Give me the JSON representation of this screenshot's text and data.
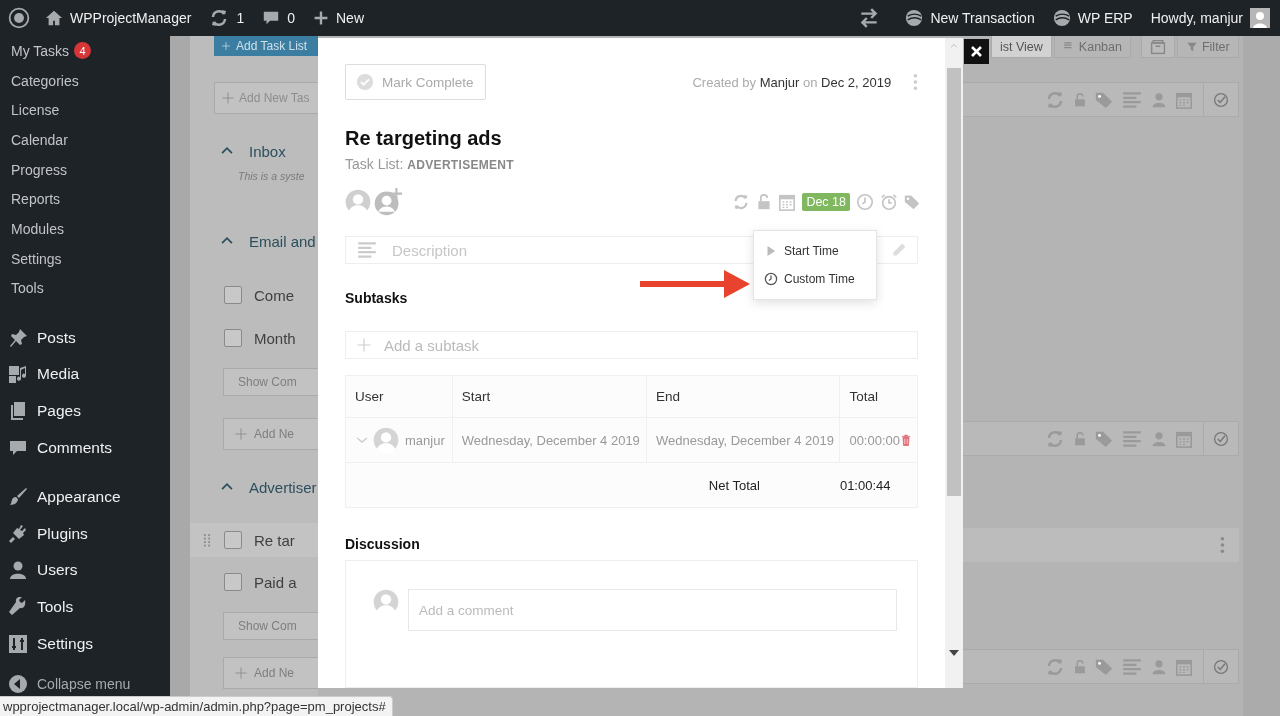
{
  "admin_bar": {
    "site": "WPProjectManager",
    "updates": "1",
    "comments": "0",
    "new": "New",
    "right_items": [
      {
        "label": "New Transaction"
      },
      {
        "label": "WP ERP"
      }
    ],
    "greeting": "Howdy, manjur"
  },
  "sidebar": {
    "submenu": [
      {
        "label": "My Tasks",
        "badge": "4"
      },
      {
        "label": "Categories"
      },
      {
        "label": "License"
      },
      {
        "label": "Calendar"
      },
      {
        "label": "Progress"
      },
      {
        "label": "Reports"
      },
      {
        "label": "Modules"
      },
      {
        "label": "Settings"
      },
      {
        "label": "Tools"
      }
    ],
    "menu_groups": [
      [
        {
          "label": "Posts"
        },
        {
          "label": "Media"
        },
        {
          "label": "Pages"
        },
        {
          "label": "Comments"
        }
      ],
      [
        {
          "label": "Appearance"
        },
        {
          "label": "Plugins"
        },
        {
          "label": "Users"
        },
        {
          "label": "Tools"
        },
        {
          "label": "Settings"
        }
      ]
    ],
    "collapse": "Collapse menu"
  },
  "project_background": {
    "add_list_button": "Add Task List",
    "new_task_placeholder": "Add New Tas",
    "lists": [
      {
        "title": "Inbox",
        "note": "This is a syste"
      },
      {
        "title": "Email and",
        "tasks": [
          {
            "label": "Come",
            "checked": false,
            "selected": false
          },
          {
            "label": "Month",
            "checked": false,
            "selected": false
          }
        ],
        "show_button": "Show Com",
        "add_button": "Add Ne"
      },
      {
        "title": "Advertiser",
        "tasks": [
          {
            "label": "Re tar",
            "checked": false,
            "selected": true
          },
          {
            "label": "Paid a",
            "checked": false,
            "selected": false
          }
        ],
        "show_button": "Show Com",
        "add_button": "Add Ne"
      }
    ],
    "view_tabs": [
      {
        "label": "ist View",
        "selected": true
      },
      {
        "label": "Kanban",
        "selected": false
      }
    ],
    "filter_button": "Filter"
  },
  "task_modal": {
    "mark_complete": "Mark Complete",
    "completed": false,
    "created_prefix": "Created by",
    "author": "Manjur",
    "on_word": "on",
    "created_date": "Dec 2, 2019",
    "title": "Re targeting ads",
    "task_list_label": "Task List:",
    "task_list_name": "ADVERTISEMENT",
    "due_badge": "Dec 18",
    "description_placeholder": "Description",
    "time_menu": [
      {
        "label": "Start Time",
        "kind": "start"
      },
      {
        "label": "Custom Time",
        "kind": "custom"
      }
    ],
    "subtasks": {
      "heading": "Subtasks",
      "placeholder": "Add a subtask"
    },
    "time_log": {
      "columns": [
        "User",
        "Start",
        "End",
        "Total"
      ],
      "rows": [
        {
          "user": "manjur",
          "start": "Wednesday, December 4 2019",
          "end": "Wednesday, December 4 2019",
          "total": "00:00:00"
        }
      ],
      "net_total_label": "Net Total",
      "net_total": "01:00:44"
    },
    "discussion": {
      "heading": "Discussion",
      "placeholder": "Add a comment"
    }
  },
  "status_url": "wpprojectmanager.local/wp-admin/admin.php?page=pm_projects#"
}
